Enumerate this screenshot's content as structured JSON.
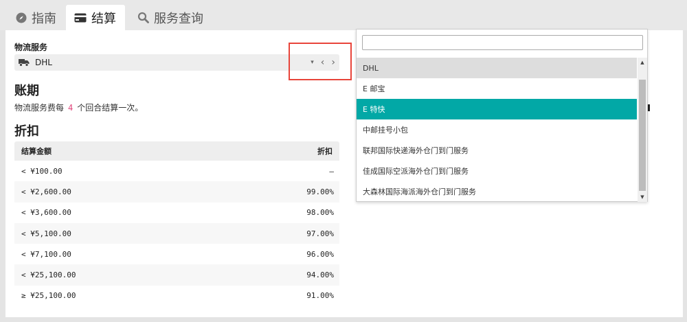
{
  "tabs": [
    {
      "label": "指南",
      "icon": "compass-icon"
    },
    {
      "label": "结算",
      "icon": "credit-card-icon",
      "active": true
    },
    {
      "label": "服务查询",
      "icon": "search-icon"
    }
  ],
  "logistics": {
    "label": "物流服务",
    "selected_value": "DHL",
    "icon": "truck-icon",
    "controls": {
      "caret": "▾",
      "prev": "‹",
      "next": "›"
    }
  },
  "billing": {
    "title": "账期",
    "text_before": "物流服务费每",
    "count": "4",
    "text_after": "个回合结算一次。"
  },
  "discount": {
    "title": "折扣",
    "columns": [
      "结算金额",
      "折扣"
    ],
    "rows": [
      {
        "amount": "< ¥100.00",
        "discount": "—"
      },
      {
        "amount": "< ¥2,600.00",
        "discount": "99.00%"
      },
      {
        "amount": "< ¥3,600.00",
        "discount": "98.00%"
      },
      {
        "amount": "< ¥5,100.00",
        "discount": "97.00%"
      },
      {
        "amount": "< ¥7,100.00",
        "discount": "96.00%"
      },
      {
        "amount": "< ¥25,100.00",
        "discount": "94.00%"
      },
      {
        "amount": "≥ ¥25,100.00",
        "discount": "91.00%"
      }
    ]
  },
  "dropdown": {
    "search_value": "",
    "options": [
      {
        "label": "DHL",
        "state": "hover"
      },
      {
        "label": "E 邮宝",
        "state": ""
      },
      {
        "label": "E 特快",
        "state": "selected"
      },
      {
        "label": "中邮挂号小包",
        "state": ""
      },
      {
        "label": "联邦国际快递海外仓门到门服务",
        "state": ""
      },
      {
        "label": "佳成国际空派海外仓门到门服务",
        "state": ""
      },
      {
        "label": "大森林国际海派海外仓门到门服务",
        "state": ""
      }
    ],
    "scroll_up": "▲",
    "scroll_down": "▼"
  },
  "colors": {
    "selected": "#02a8a6",
    "highlight_box": "#e8443a",
    "count_accent": "#e0457b"
  }
}
